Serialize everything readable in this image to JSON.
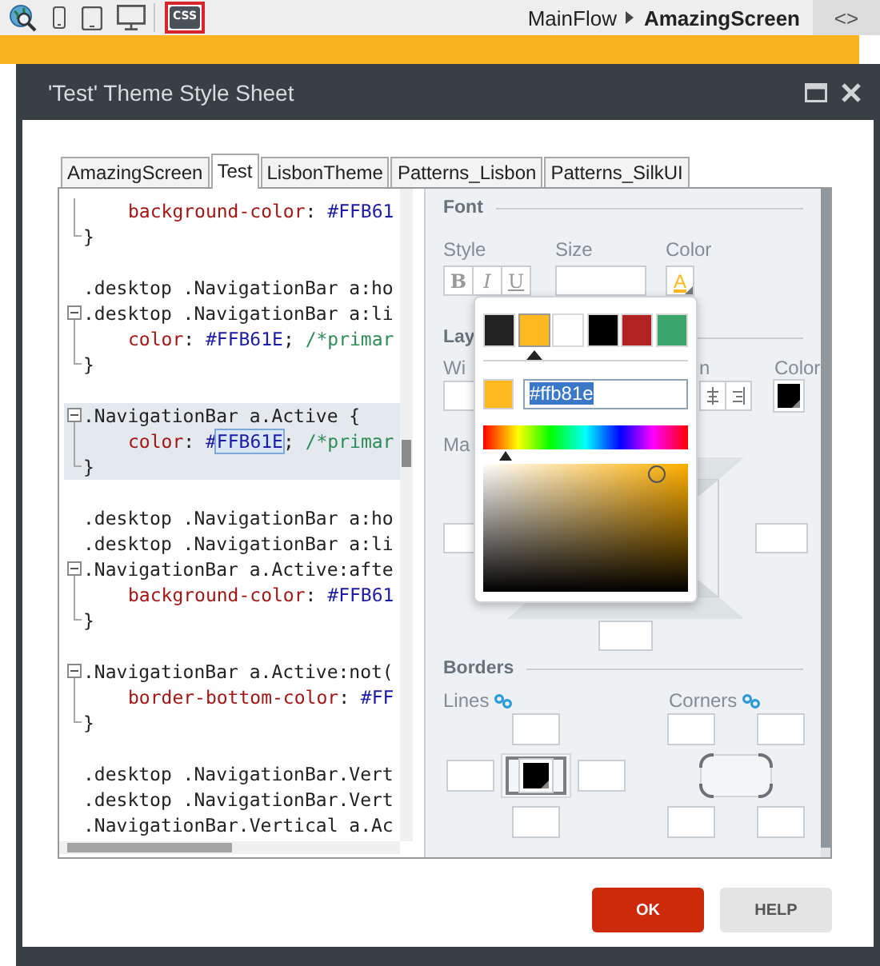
{
  "toolbar": {
    "css_label": "CSS",
    "breadcrumb": [
      {
        "label": "MainFlow",
        "current": false
      },
      {
        "label": "AmazingScreen",
        "current": true
      }
    ],
    "code_toggle": "<>"
  },
  "dialog": {
    "title": "'Test' Theme Style Sheet",
    "tabs": [
      {
        "label": "AmazingScreen",
        "selected": false
      },
      {
        "label": "Test",
        "selected": true
      },
      {
        "label": "LisbonTheme",
        "selected": false
      },
      {
        "label": "Patterns_Lisbon",
        "selected": false
      },
      {
        "label": "Patterns_SilkUI",
        "selected": false
      }
    ],
    "editor": {
      "lines": [
        {
          "kind": "code",
          "indented": true,
          "highlighted": false,
          "segments": [
            {
              "kind": "property",
              "text": "background-color"
            },
            {
              "kind": "punct",
              "text": ": "
            },
            {
              "kind": "value",
              "text": "#FFB61"
            }
          ]
        },
        {
          "kind": "code",
          "indented": false,
          "highlighted": false,
          "segments": [
            {
              "kind": "close",
              "text": "}"
            }
          ]
        },
        {
          "kind": "blank"
        },
        {
          "kind": "code",
          "indented": false,
          "highlighted": false,
          "segments": [
            {
              "kind": "selector",
              "text": ".desktop .NavigationBar a:ho"
            }
          ]
        },
        {
          "kind": "block_start",
          "indented": false,
          "highlighted": false,
          "segments": [
            {
              "kind": "selector",
              "text": ".desktop .NavigationBar a:li"
            }
          ]
        },
        {
          "kind": "code",
          "indented": true,
          "highlighted": false,
          "segments": [
            {
              "kind": "property",
              "text": "color"
            },
            {
              "kind": "punct",
              "text": ": "
            },
            {
              "kind": "value",
              "text": "#FFB61E"
            },
            {
              "kind": "punct",
              "text": "; "
            },
            {
              "kind": "comment",
              "text": "/*primar"
            }
          ]
        },
        {
          "kind": "code",
          "indented": false,
          "highlighted": false,
          "segments": [
            {
              "kind": "close",
              "text": "}"
            }
          ]
        },
        {
          "kind": "blank"
        },
        {
          "kind": "block_start",
          "indented": false,
          "highlighted": true,
          "segments": [
            {
              "kind": "selector",
              "text": ".NavigationBar a.Active {"
            }
          ]
        },
        {
          "kind": "code",
          "indented": true,
          "highlighted": true,
          "segments": [
            {
              "kind": "property",
              "text": "color"
            },
            {
              "kind": "punct",
              "text": ": "
            },
            {
              "kind": "value",
              "text": "#"
            },
            {
              "kind": "match",
              "text": "FFB61E"
            },
            {
              "kind": "punct",
              "text": "; "
            },
            {
              "kind": "comment",
              "text": "/*primar"
            }
          ]
        },
        {
          "kind": "code",
          "indented": false,
          "highlighted": true,
          "segments": [
            {
              "kind": "close",
              "text": "}"
            }
          ]
        },
        {
          "kind": "blank"
        },
        {
          "kind": "code",
          "indented": false,
          "highlighted": false,
          "segments": [
            {
              "kind": "selector",
              "text": ".desktop .NavigationBar a:ho"
            }
          ]
        },
        {
          "kind": "code",
          "indented": false,
          "highlighted": false,
          "segments": [
            {
              "kind": "selector",
              "text": ".desktop .NavigationBar a:li"
            }
          ]
        },
        {
          "kind": "block_start",
          "indented": false,
          "highlighted": false,
          "segments": [
            {
              "kind": "selector",
              "text": ".NavigationBar a.Active:afte"
            }
          ]
        },
        {
          "kind": "code",
          "indented": true,
          "highlighted": false,
          "segments": [
            {
              "kind": "property",
              "text": "background-color"
            },
            {
              "kind": "punct",
              "text": ": "
            },
            {
              "kind": "value",
              "text": "#FFB61"
            }
          ]
        },
        {
          "kind": "code",
          "indented": false,
          "highlighted": false,
          "segments": [
            {
              "kind": "close",
              "text": "}"
            }
          ]
        },
        {
          "kind": "blank"
        },
        {
          "kind": "block_start",
          "indented": false,
          "highlighted": false,
          "segments": [
            {
              "kind": "selector",
              "text": ".NavigationBar a.Active:not("
            }
          ]
        },
        {
          "kind": "code",
          "indented": true,
          "highlighted": false,
          "segments": [
            {
              "kind": "property",
              "text": "border-bottom-color"
            },
            {
              "kind": "punct",
              "text": ": "
            },
            {
              "kind": "value",
              "text": "#FF"
            }
          ]
        },
        {
          "kind": "code",
          "indented": false,
          "highlighted": false,
          "segments": [
            {
              "kind": "close",
              "text": "}"
            }
          ]
        },
        {
          "kind": "blank"
        },
        {
          "kind": "code",
          "indented": false,
          "highlighted": false,
          "segments": [
            {
              "kind": "selector",
              "text": ".desktop .NavigationBar.Vert"
            }
          ]
        },
        {
          "kind": "code",
          "indented": false,
          "highlighted": false,
          "segments": [
            {
              "kind": "selector",
              "text": ".desktop .NavigationBar.Vert"
            }
          ]
        },
        {
          "kind": "code",
          "indented": false,
          "highlighted": false,
          "segments": [
            {
              "kind": "selector",
              "text": ".NavigationBar.Vertical a.Ac"
            }
          ]
        }
      ]
    },
    "properties": {
      "font": {
        "title": "Font",
        "style_label": "Style",
        "style_buttons": [
          {
            "label": "B",
            "kind": "bold"
          },
          {
            "label": "I",
            "kind": "italic"
          },
          {
            "label": "U",
            "kind": "underline"
          }
        ],
        "size_label": "Size",
        "color_label": "Color",
        "color_button": "A"
      },
      "layout": {
        "title": "Lay",
        "width_label": "Wi",
        "align_label": "n",
        "color_label": "Color",
        "color": "#000000",
        "margin_label": "Ma"
      },
      "borders": {
        "title": "Borders",
        "lines_label": "Lines",
        "corners_label": "Corners",
        "color": "#000000"
      },
      "color_picker": {
        "swatches": [
          {
            "color": "#222222",
            "selected": false
          },
          {
            "color": "#ffb81e",
            "selected": true
          },
          {
            "color": "#ffffff",
            "selected": false
          },
          {
            "color": "#000000",
            "selected": false
          },
          {
            "color": "#b22222",
            "selected": false
          },
          {
            "color": "#3aa56b",
            "selected": false
          }
        ],
        "current": {
          "color": "#ffb81e",
          "hex": "#ffb81e"
        },
        "hue": {
          "level": 0.11
        }
      }
    },
    "buttons": [
      {
        "label": "OK",
        "kind": "primary"
      },
      {
        "label": "HELP",
        "kind": "secondary"
      }
    ]
  }
}
